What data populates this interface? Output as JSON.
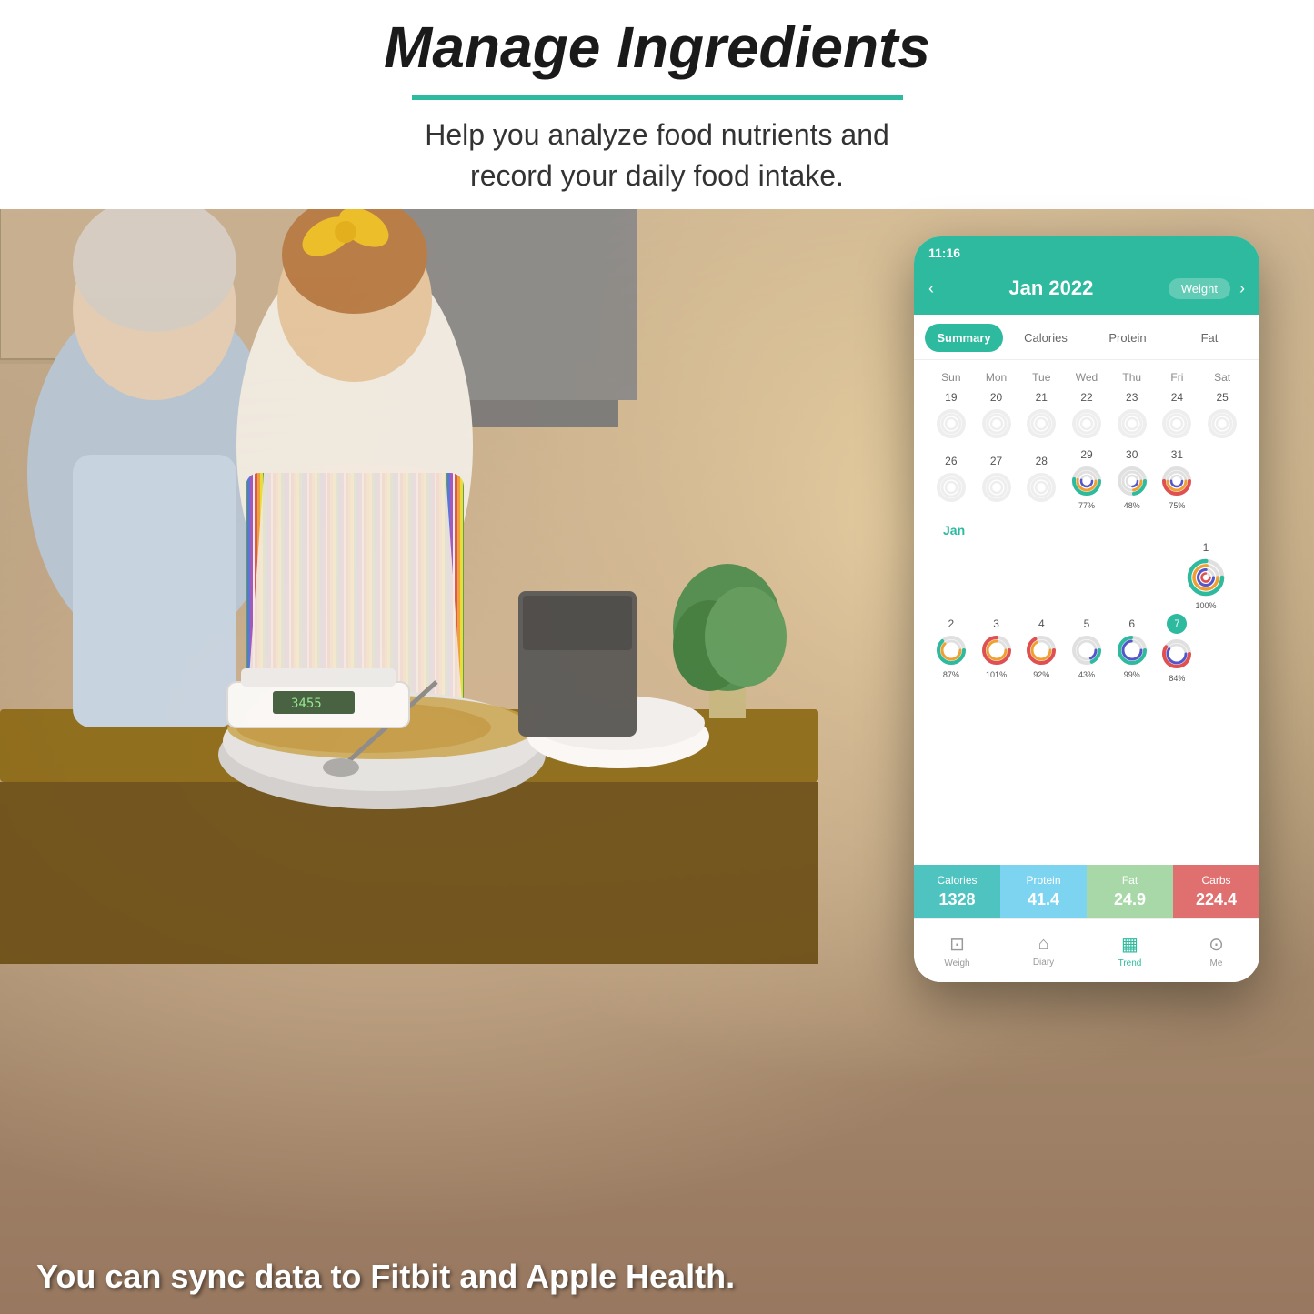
{
  "header": {
    "title": "Manage Ingredients",
    "subtitle_line1": "Help you analyze food nutrients and",
    "subtitle_line2": "record your daily food intake."
  },
  "bottom_text": "You can sync data to Fitbit and Apple Health.",
  "phone": {
    "status_time": "11:16",
    "month_title": "Jan 2022",
    "weight_button": "Weight",
    "tabs": [
      "Summary",
      "Calories",
      "Protein",
      "Fat"
    ],
    "active_tab": "Summary",
    "day_headers": [
      "Sun",
      "Mon",
      "Tue",
      "Wed",
      "Thu",
      "Fri",
      "Sat"
    ],
    "week1": {
      "days": [
        19,
        20,
        21,
        22,
        23,
        24,
        25
      ],
      "data": [
        null,
        null,
        null,
        null,
        null,
        null,
        null
      ]
    },
    "week2": {
      "days": [
        26,
        27,
        28,
        29,
        30,
        31,
        ""
      ],
      "data": [
        null,
        null,
        null,
        {
          "pct": 77,
          "colors": [
            "#2dba9e",
            "#f0a030",
            "#5555cc"
          ]
        },
        {
          "pct": 48,
          "colors": [
            "#2dba9e",
            "#f0a030",
            "#5555cc"
          ]
        },
        {
          "pct": 75,
          "colors": [
            "#e05050",
            "#f0a030",
            "#5555cc"
          ]
        },
        null
      ]
    },
    "jan_month_label": "Jan",
    "jan_day1": {
      "day": 1,
      "pct": 100,
      "colors": [
        "#2dba9e",
        "#f0a030",
        "#5555cc",
        "#e05050"
      ]
    },
    "week3": {
      "days": [
        2,
        3,
        4,
        5,
        6,
        7,
        ""
      ],
      "today": 7,
      "data": [
        {
          "pct": 87,
          "colors": [
            "#2dba9e",
            "#f0a030"
          ]
        },
        {
          "pct": 101,
          "colors": [
            "#e05050",
            "#f0a030"
          ]
        },
        {
          "pct": 92,
          "colors": [
            "#e05050",
            "#f0a030"
          ]
        },
        {
          "pct": 43,
          "colors": [
            "#2dba9e",
            "#5555cc"
          ]
        },
        {
          "pct": 99,
          "colors": [
            "#2dba9e",
            "#5555cc"
          ]
        },
        {
          "pct": 84,
          "colors": [
            "#e05050",
            "#5555cc"
          ]
        }
      ]
    },
    "stats": [
      {
        "label": "Calories",
        "value": "1328",
        "class": "calories"
      },
      {
        "label": "Protein",
        "value": "41.4",
        "class": "protein"
      },
      {
        "label": "Fat",
        "value": "24.9",
        "class": "fat"
      },
      {
        "label": "Carbs",
        "value": "224.4",
        "class": "carbs"
      }
    ],
    "nav": [
      {
        "label": "Weigh",
        "icon": "⊡",
        "active": false
      },
      {
        "label": "Diary",
        "icon": "⌂",
        "active": false
      },
      {
        "label": "Trend",
        "icon": "▦",
        "active": true
      },
      {
        "label": "Me",
        "icon": "⊙",
        "active": false
      }
    ]
  }
}
